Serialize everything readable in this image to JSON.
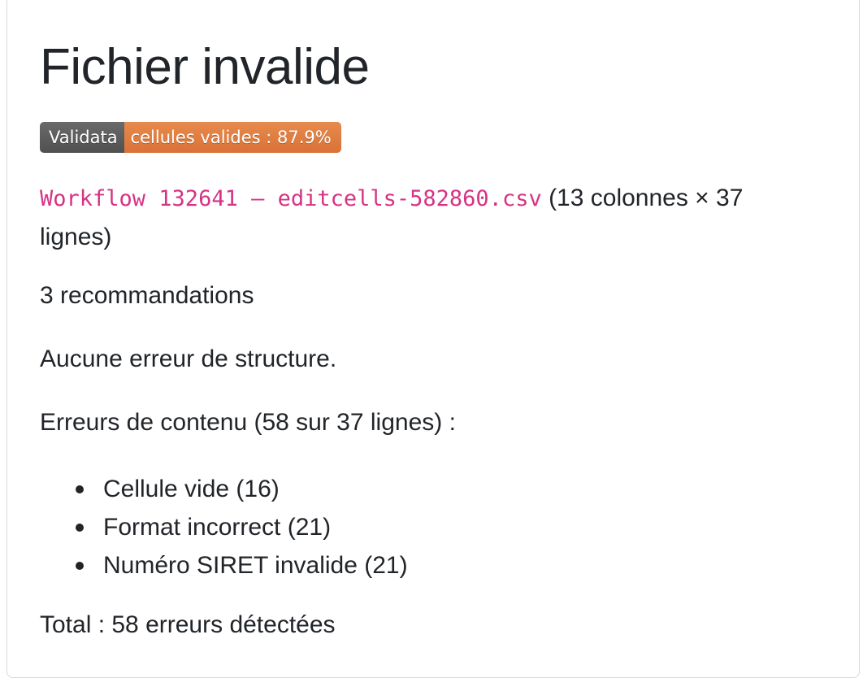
{
  "title": "Fichier invalide",
  "badge": {
    "label": "Validata",
    "value": "cellules valides : 87.9%",
    "label_color": "#555555",
    "value_color": "#e07b40"
  },
  "file": {
    "name": "Workflow 132641 – editcells-582860.csv",
    "dimensions": "(13 colonnes × 37 lignes)"
  },
  "recommendations": "3 recommandations",
  "structure_errors": "Aucune erreur de structure.",
  "content_errors_heading": "Erreurs de contenu (58 sur 37 lignes) :",
  "error_items": [
    "Cellule vide (16)",
    "Format incorrect (21)",
    "Numéro SIRET invalide (21)"
  ],
  "total": "Total : 58 erreurs détectées",
  "colors": {
    "code_text": "#d63384",
    "body_text": "#212529"
  }
}
